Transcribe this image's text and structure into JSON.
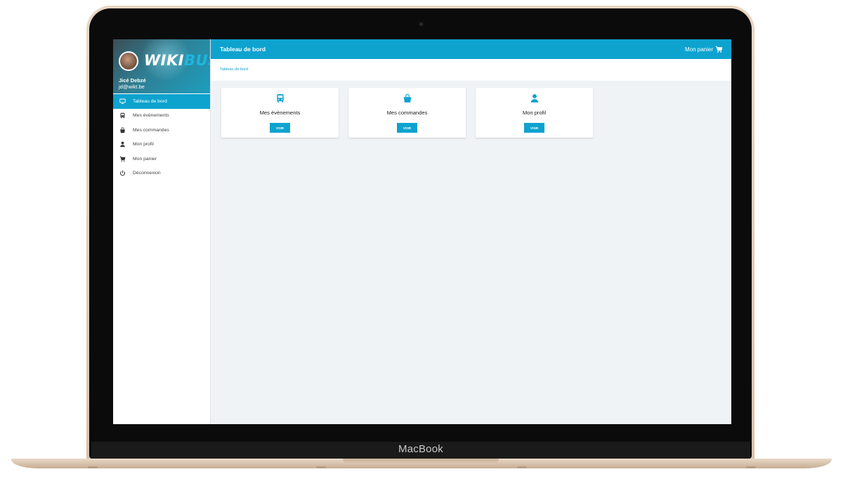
{
  "device": {
    "brand": "MacBook"
  },
  "sidebar": {
    "logo": {
      "part1": "WIKI",
      "part2": "BUS"
    },
    "user": {
      "name": "Jicé Debzé",
      "email": "jd@wikt.be"
    },
    "items": [
      {
        "label": "Tableau de bord",
        "icon": "monitor-icon",
        "active": true
      },
      {
        "label": "Mes évènements",
        "icon": "bus-icon"
      },
      {
        "label": "Mes commandes",
        "icon": "shopping-bag-icon"
      },
      {
        "label": "Mon profil",
        "icon": "person-icon"
      },
      {
        "label": "Mon panier",
        "icon": "cart-icon"
      },
      {
        "label": "Déconnexion",
        "icon": "power-icon"
      }
    ]
  },
  "topbar": {
    "title": "Tableau de bord",
    "cart_label": "Mon panier",
    "cart_icon": "cart-icon"
  },
  "breadcrumb": {
    "current": "Tableau de bord"
  },
  "cards": [
    {
      "title": "Mes évènements",
      "icon": "bus-icon",
      "button": "VOIR"
    },
    {
      "title": "Mes commandes",
      "icon": "shopping-bag-icon",
      "button": "VOIR"
    },
    {
      "title": "Mon profil",
      "icon": "person-icon",
      "button": "VOIR"
    }
  ],
  "colors": {
    "accent": "#0ea3cf",
    "background": "#eff3f6",
    "logo_highlight": "#1eb6e0"
  }
}
